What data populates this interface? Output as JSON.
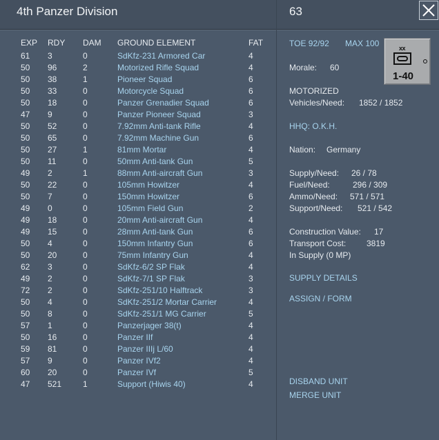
{
  "left": {
    "title": "4th Panzer Division",
    "columns": {
      "exp": "EXP",
      "rdy": "RDY",
      "dam": "DAM",
      "element": "GROUND ELEMENT",
      "fat": "FAT"
    },
    "rows": [
      {
        "exp": "61",
        "rdy": "3",
        "dam": "0",
        "name": "SdKfz-231 Armored Car",
        "fat": "4"
      },
      {
        "exp": "50",
        "rdy": "96",
        "dam": "2",
        "name": "Motorized Rifle Squad",
        "fat": "4"
      },
      {
        "exp": "50",
        "rdy": "38",
        "dam": "1",
        "name": "Pioneer Squad",
        "fat": "6"
      },
      {
        "exp": "50",
        "rdy": "33",
        "dam": "0",
        "name": "Motorcycle Squad",
        "fat": "6"
      },
      {
        "exp": "50",
        "rdy": "18",
        "dam": "0",
        "name": "Panzer Grenadier Squad",
        "fat": "6"
      },
      {
        "exp": "47",
        "rdy": "9",
        "dam": "0",
        "name": "Panzer Pioneer Squad",
        "fat": "3"
      },
      {
        "exp": "50",
        "rdy": "52",
        "dam": "0",
        "name": "7.92mm Anti-tank Rifle",
        "fat": "4"
      },
      {
        "exp": "50",
        "rdy": "65",
        "dam": "0",
        "name": "7.92mm Machine Gun",
        "fat": "6"
      },
      {
        "exp": "50",
        "rdy": "27",
        "dam": "1",
        "name": "81mm Mortar",
        "fat": "4"
      },
      {
        "exp": "50",
        "rdy": "11",
        "dam": "0",
        "name": "50mm Anti-tank Gun",
        "fat": "5"
      },
      {
        "exp": "49",
        "rdy": "2",
        "dam": "1",
        "name": "88mm Anti-aircraft Gun",
        "fat": "3"
      },
      {
        "exp": "50",
        "rdy": "22",
        "dam": "0",
        "name": "105mm Howitzer",
        "fat": "4"
      },
      {
        "exp": "50",
        "rdy": "7",
        "dam": "0",
        "name": "150mm Howitzer",
        "fat": "6"
      },
      {
        "exp": "49",
        "rdy": "0",
        "dam": "0",
        "name": "105mm Field Gun",
        "fat": "2"
      },
      {
        "exp": "49",
        "rdy": "18",
        "dam": "0",
        "name": "20mm Anti-aircraft Gun",
        "fat": "4"
      },
      {
        "exp": "49",
        "rdy": "15",
        "dam": "0",
        "name": "28mm Anti-tank Gun",
        "fat": "6"
      },
      {
        "exp": "50",
        "rdy": "4",
        "dam": "0",
        "name": "150mm Infantry Gun",
        "fat": "6"
      },
      {
        "exp": "50",
        "rdy": "20",
        "dam": "0",
        "name": "75mm Infantry Gun",
        "fat": "4"
      },
      {
        "exp": "62",
        "rdy": "3",
        "dam": "0",
        "name": "SdKfz-6/2 SP Flak",
        "fat": "4"
      },
      {
        "exp": "49",
        "rdy": "2",
        "dam": "0",
        "name": "SdKfz-7/1 SP Flak",
        "fat": "3"
      },
      {
        "exp": "72",
        "rdy": "2",
        "dam": "0",
        "name": "SdKfz-251/10 Halftrack",
        "fat": "3"
      },
      {
        "exp": "50",
        "rdy": "4",
        "dam": "0",
        "name": "SdKfz-251/2 Mortar Carrier",
        "fat": "4"
      },
      {
        "exp": "50",
        "rdy": "8",
        "dam": "0",
        "name": "SdKfz-251/1 MG Carrier",
        "fat": "5"
      },
      {
        "exp": "57",
        "rdy": "1",
        "dam": "0",
        "name": "Panzerjager 38(t)",
        "fat": "4"
      },
      {
        "exp": "50",
        "rdy": "16",
        "dam": "0",
        "name": "Panzer IIf",
        "fat": "4"
      },
      {
        "exp": "59",
        "rdy": "81",
        "dam": "0",
        "name": "Panzer IIIj L/60",
        "fat": "4"
      },
      {
        "exp": "57",
        "rdy": "9",
        "dam": "0",
        "name": "Panzer IVf2",
        "fat": "4"
      },
      {
        "exp": "60",
        "rdy": "20",
        "dam": "0",
        "name": "Panzer IVf",
        "fat": "5"
      },
      {
        "exp": "47",
        "rdy": "521",
        "dam": "1",
        "name": "Support (Hiwis 40)",
        "fat": "4"
      }
    ]
  },
  "right": {
    "unit_id": "63",
    "close_glyph": "close-icon",
    "toe": "TOE 92/92",
    "max": "MAX 100",
    "morale_label": "Morale:",
    "morale_value": "60",
    "type": "MOTORIZED",
    "vehicles_label": "Vehicles/Need:",
    "vehicles_value": "1852 / 1852",
    "hhq": "HHQ: O.K.H.",
    "nation_label": "Nation:",
    "nation_value": "Germany",
    "supply_label": "Supply/Need:",
    "supply_value": "26 / 78",
    "fuel_label": "Fuel/Need:",
    "fuel_value": "296 / 309",
    "ammo_label": "Ammo/Need:",
    "ammo_value": "571 / 571",
    "support_label": "Support/Need:",
    "support_value": "521 / 542",
    "construction_label": "Construction Value:",
    "construction_value": "17",
    "transport_label": "Transport Cost:",
    "transport_value": "3819",
    "in_supply": "In Supply (0 MP)",
    "supply_details": "SUPPLY DETAILS",
    "assign_form": "ASSIGN / FORM",
    "disband": "DISBAND UNIT",
    "merge": "MERGE UNIT",
    "counter": {
      "size": "xx",
      "strength": "1-40"
    }
  }
}
